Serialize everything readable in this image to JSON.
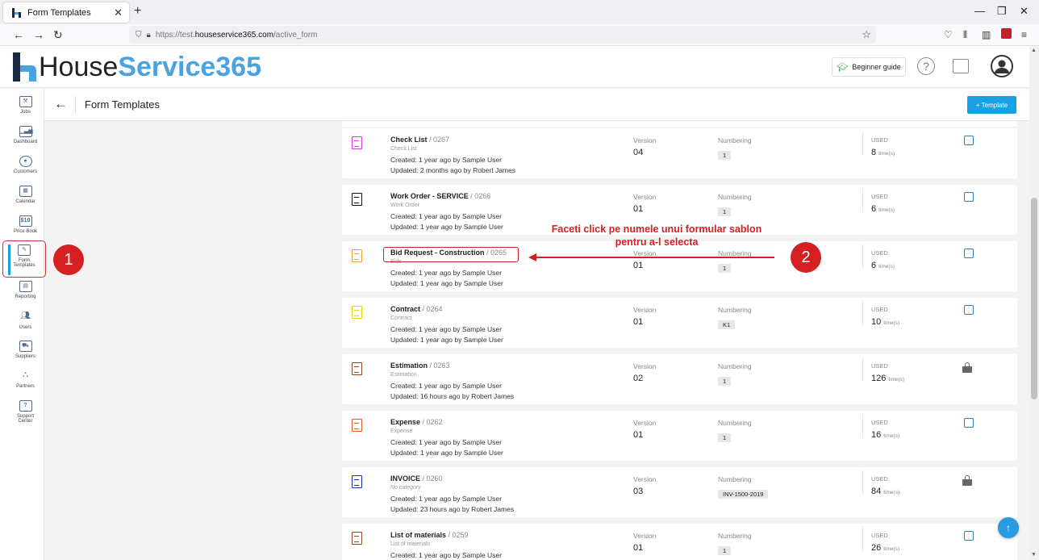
{
  "browser": {
    "tab_title": "Form Templates",
    "new_tab": "+",
    "url_prefix": "https://test.",
    "url_host": "houseservice365.com",
    "url_path": "/active_form"
  },
  "header": {
    "logo_house": "House",
    "logo_service": "Service365",
    "beginner_guide": "Beginner guide",
    "help_symbol": "?"
  },
  "toolbar": {
    "title": "Form Templates",
    "add_button": "+  Template"
  },
  "sidebar": {
    "items": [
      {
        "label": "Jobs",
        "icon": "tools-icon"
      },
      {
        "label": "Dashboard",
        "icon": "bar-chart-icon"
      },
      {
        "label": "Customers",
        "icon": "customers-icon"
      },
      {
        "label": "Calendar",
        "icon": "calendar-icon"
      },
      {
        "label": "Price Book",
        "icon": "price-book-icon",
        "glyph": "$10"
      },
      {
        "label_line1": "Form",
        "label_line2": "Templates",
        "icon": "form-templates-icon"
      },
      {
        "label": "Reporting",
        "icon": "reporting-icon"
      },
      {
        "label": "Users",
        "icon": "users-icon"
      },
      {
        "label": "Suppliers",
        "icon": "truck-icon"
      },
      {
        "label": "Partners",
        "icon": "partners-icon"
      },
      {
        "label_line1": "Support",
        "label_line2": "Center",
        "icon": "support-icon",
        "glyph": "?"
      }
    ]
  },
  "columns": {
    "version": "Version",
    "numbering": "Numbering",
    "used": "USED",
    "times": "time(s)"
  },
  "templates": [
    {
      "name": "Check List",
      "code": " / 0267",
      "category": "Check List",
      "created": "Created: 1 year ago by Sample User",
      "updated": "Updated: 2 months ago by Robert James",
      "version": "04",
      "numbering": "1",
      "used": "8",
      "locked": false,
      "icon_color": "#d63fd6"
    },
    {
      "name": "Work Order - SERVICE",
      "code": " / 0266",
      "category": "Work Order",
      "created": "Created: 1 year ago by Sample User",
      "updated": "Updated: 1 year ago by Sample User",
      "version": "01",
      "numbering": "1",
      "used": "6",
      "locked": false,
      "icon_color": "#111111"
    },
    {
      "name": "Bid Request - Construction",
      "code": " / 0265",
      "category": "Bids",
      "created": "Created: 1 year ago by Sample User",
      "updated": "Updated: 1 year ago by Sample User",
      "version": "01",
      "numbering": "1",
      "used": "6",
      "locked": false,
      "icon_color": "#f0a030"
    },
    {
      "name": "Contract",
      "code": " / 0264",
      "category": "Contract",
      "created": "Created: 1 year ago by Sample User",
      "updated": "Updated: 1 year ago by Sample User",
      "version": "01",
      "numbering": "K1",
      "used": "10",
      "locked": false,
      "icon_color": "#e8d400"
    },
    {
      "name": "Estimation",
      "code": " / 0263",
      "category": "Estimation",
      "created": "Created: 1 year ago by Sample User",
      "updated": "Updated: 16 hours ago by Robert James",
      "version": "02",
      "numbering": "1",
      "used": "126",
      "locked": true,
      "icon_color": "#8a4a2a"
    },
    {
      "name": "Expense",
      "code": " / 0262",
      "category": "Expense",
      "created": "Created: 1 year ago by Sample User",
      "updated": "Updated: 1 year ago by Sample User",
      "version": "01",
      "numbering": "1",
      "used": "16",
      "locked": false,
      "icon_color": "#e85a20"
    },
    {
      "name": "INVOICE",
      "code": " / 0260",
      "category": "No category",
      "created": "Created: 1 year ago by Sample User",
      "updated": "Updated: 23 hours ago by Robert James",
      "version": "03",
      "numbering": "INV-1500-2019",
      "used": "84",
      "locked": true,
      "icon_color": "#1a2fb0"
    },
    {
      "name": "List of materials",
      "code": " / 0259",
      "category": "List of materials",
      "created": "Created: 1 year ago by Sample User",
      "updated": "",
      "version": "01",
      "numbering": "1",
      "used": "26",
      "locked": false,
      "icon_color": "#8a4a2a"
    }
  ],
  "annotations": {
    "step1": "1",
    "step2": "2",
    "instruction_line1": "Faceti click pe numele unui formular sablon",
    "instruction_line2": "pentru a-l selecta"
  },
  "fab_symbol": "↑"
}
